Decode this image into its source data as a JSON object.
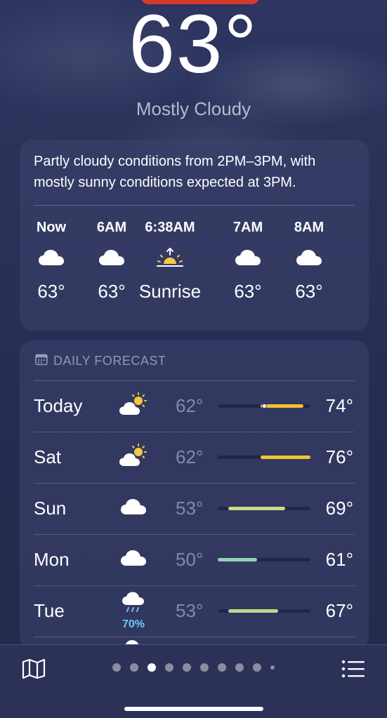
{
  "current": {
    "temperature": "63°",
    "condition": "Mostly Cloudy"
  },
  "hourly": {
    "summary": "Partly cloudy conditions from 2PM–3PM, with mostly sunny conditions expected at 3PM.",
    "items": [
      {
        "time": "Now",
        "icon": "cloud-icon",
        "value": "63°"
      },
      {
        "time": "6AM",
        "icon": "cloud-icon",
        "value": "63°"
      },
      {
        "time": "6:38AM",
        "icon": "sunrise-icon",
        "value": "Sunrise"
      },
      {
        "time": "7AM",
        "icon": "cloud-icon",
        "value": "63°"
      },
      {
        "time": "8AM",
        "icon": "cloud-icon",
        "value": "63°"
      }
    ]
  },
  "daily": {
    "header": "DAILY FORECAST",
    "scale": {
      "min": 50,
      "max": 76
    },
    "days": [
      {
        "day": "Today",
        "icon": "partly-sunny-icon",
        "precip": "",
        "low": "62°",
        "high": "74°",
        "low_value": 62,
        "high_value": 74,
        "current_value": 63,
        "bar_color": "#f2c230"
      },
      {
        "day": "Sat",
        "icon": "partly-sunny-icon",
        "precip": "",
        "low": "62°",
        "high": "76°",
        "low_value": 62,
        "high_value": 76,
        "bar_color": "#f2c230"
      },
      {
        "day": "Sun",
        "icon": "cloud-icon",
        "precip": "",
        "low": "53°",
        "high": "69°",
        "low_value": 53,
        "high_value": 69,
        "bar_color": "#c9d98a"
      },
      {
        "day": "Mon",
        "icon": "cloud-icon",
        "precip": "",
        "low": "50°",
        "high": "61°",
        "low_value": 50,
        "high_value": 61,
        "bar_color": "#8fd3b8"
      },
      {
        "day": "Tue",
        "icon": "rain-cloud-icon",
        "precip": "70%",
        "low": "53°",
        "high": "67°",
        "low_value": 53,
        "high_value": 67,
        "bar_color": "#b8d98f"
      }
    ]
  },
  "bottom_bar": {
    "map_icon": "map-icon",
    "list_icon": "list-icon",
    "page_count": 10,
    "active_page": 3
  },
  "colors": {
    "precip": "#6ec6f5",
    "sun": "#f5c842",
    "accent_bar": "#f2c230"
  }
}
